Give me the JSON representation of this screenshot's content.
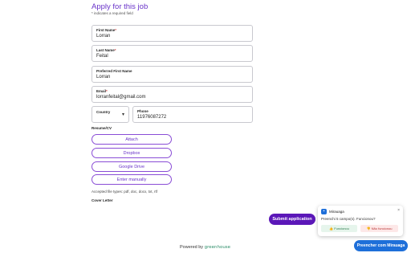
{
  "form": {
    "title": "Apply for this job",
    "required_note": "* indicates a required field",
    "required_mark": "*",
    "first_name": {
      "label": "First Name",
      "value": "Lorran"
    },
    "last_name": {
      "label": "Last Name",
      "value": "Feital"
    },
    "preferred_name": {
      "label": "Preferred First Name",
      "value": "Lorran"
    },
    "email": {
      "label": "Email",
      "value": "lorranfeital@gmail.com"
    },
    "country": {
      "label": "Country"
    },
    "phone": {
      "label": "Phone",
      "value": "11976087272"
    },
    "resume": {
      "label": "Resume/CV",
      "buttons": [
        "Attach",
        "Dropbox",
        "Google Drive",
        "Enter manually"
      ],
      "accepted": "Accepted file types: pdf, doc, docx, txt, rtf"
    },
    "cover_letter_label": "Cover Letter",
    "submit_label": "Submit application"
  },
  "footer": {
    "powered_by": "Powered by",
    "brand": "greenhouse"
  },
  "extension": {
    "name": "Mirauaga",
    "close": "×",
    "message": "Preenchi 5 campo(s). Funcionou?",
    "yes_label": "👍 Funcionou",
    "no_label": "👎 Não funcionou",
    "fill_button": "Preencher com Mirauaga"
  },
  "colors": {
    "accent": "#6a34c9",
    "submit": "#5b17b8",
    "extension_blue": "#1e6fd9"
  }
}
